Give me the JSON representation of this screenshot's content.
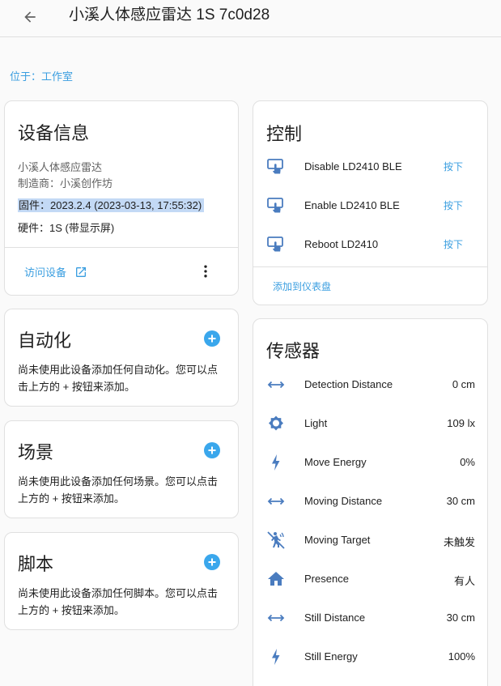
{
  "header": {
    "title": "小溪人体感应雷达 1S 7c0d28",
    "back_icon": "arrow-left-icon"
  },
  "location": "位于：工作室",
  "device_info": {
    "title": "设备信息",
    "model": "小溪人体感应雷达",
    "manufacturer": "制造商：小溪创作坊",
    "firmware": "固件：2023.2.4 (2023-03-13, 17:55:32)",
    "hardware": "硬件：1S (带显示屏)",
    "visit_label": "访问设备",
    "visit_icon": "open-in-new-icon",
    "more_icon": "dots-vertical-icon"
  },
  "automation": {
    "title": "自动化",
    "description": "尚未使用此设备添加任何自动化。您可以点击上方的 + 按钮来添加。"
  },
  "scene": {
    "title": "场景",
    "description": "尚未使用此设备添加任何场景。您可以点击上方的 + 按钮来添加。"
  },
  "script": {
    "title": "脚本",
    "description": "尚未使用此设备添加任何脚本。您可以点击上方的 + 按钮来添加。"
  },
  "controls": {
    "title": "控制",
    "items": [
      {
        "label": "Disable LD2410 BLE",
        "button": "按下",
        "icon": "gesture-tap-button-icon"
      },
      {
        "label": "Enable LD2410 BLE",
        "button": "按下",
        "icon": "gesture-tap-button-icon"
      },
      {
        "label": "Reboot LD2410",
        "button": "按下",
        "icon": "gesture-tap-button-icon"
      }
    ],
    "add_to_dashboard": "添加到仪表盘"
  },
  "sensors": {
    "title": "传感器",
    "items": [
      {
        "label": "Detection Distance",
        "value": "0 cm",
        "icon": "arrow-left-right-icon"
      },
      {
        "label": "Light",
        "value": "109 lx",
        "icon": "brightness-icon"
      },
      {
        "label": "Move Energy",
        "value": "0%",
        "icon": "flash-icon"
      },
      {
        "label": "Moving Distance",
        "value": "30 cm",
        "icon": "arrow-left-right-icon"
      },
      {
        "label": "Moving Target",
        "value": "未触发",
        "icon": "motion-sensor-off-icon"
      },
      {
        "label": "Presence",
        "value": "有人",
        "icon": "home-icon"
      },
      {
        "label": "Still Distance",
        "value": "30 cm",
        "icon": "arrow-left-right-icon"
      },
      {
        "label": "Still Energy",
        "value": "100%",
        "icon": "flash-icon"
      }
    ]
  },
  "colors": {
    "accent": "#3a9ee0",
    "icon": "#4a7cbf",
    "highlight": "#c3d9f5"
  }
}
